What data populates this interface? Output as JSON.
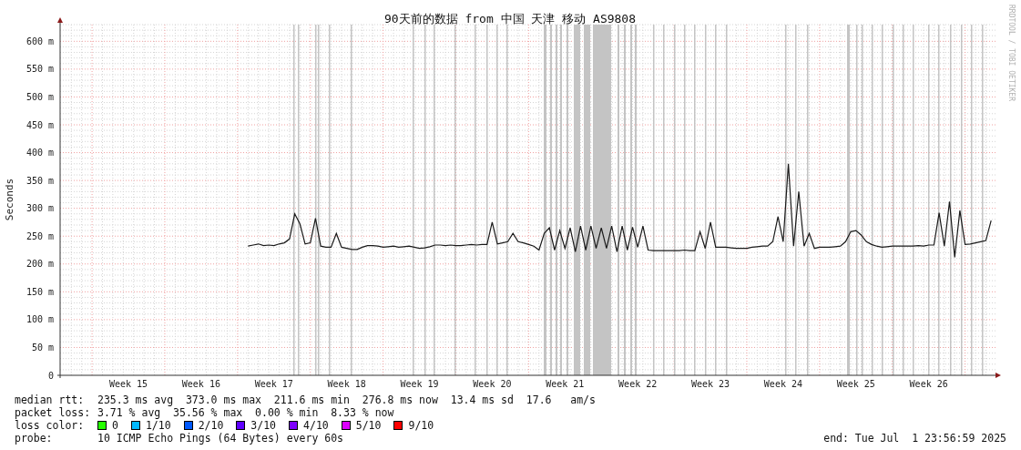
{
  "credit": "RRDTOOL / TOBI OETIKER",
  "chart_data": {
    "type": "line",
    "title": "90天前的数据 from 中国 天津 移动 AS9808",
    "ylabel": "Seconds",
    "grid": true,
    "ylim": [
      0,
      630
    ],
    "yticks": [
      {
        "value": 0,
        "label": "0"
      },
      {
        "value": 50,
        "label": "50 m"
      },
      {
        "value": 100,
        "label": "100 m"
      },
      {
        "value": 150,
        "label": "150 m"
      },
      {
        "value": 200,
        "label": "200 m"
      },
      {
        "value": 250,
        "label": "250 m"
      },
      {
        "value": 300,
        "label": "300 m"
      },
      {
        "value": 350,
        "label": "350 m"
      },
      {
        "value": 400,
        "label": "400 m"
      },
      {
        "value": 450,
        "label": "450 m"
      },
      {
        "value": 500,
        "label": "500 m"
      },
      {
        "value": 550,
        "label": "550 m"
      },
      {
        "value": 600,
        "label": "600 m"
      }
    ],
    "categories": [
      null,
      null,
      null,
      null,
      null,
      null,
      null,
      null,
      null,
      null,
      null,
      null,
      null,
      "Week 15",
      null,
      null,
      null,
      null,
      null,
      null,
      null,
      null,
      null,
      null,
      null,
      null,
      null,
      "Week 16",
      null,
      null,
      null,
      null,
      null,
      null,
      null,
      null,
      null,
      null,
      null,
      null,
      null,
      "Week 17",
      null,
      null,
      null,
      null,
      null,
      null,
      null,
      null,
      null,
      null,
      null,
      null,
      null,
      "Week 18",
      null,
      null,
      null,
      null,
      null,
      null,
      null,
      null,
      null,
      null,
      null,
      null,
      null,
      "Week 19",
      null,
      null,
      null,
      null,
      null,
      null,
      null,
      null,
      null,
      null,
      null,
      null,
      null,
      "Week 20",
      null,
      null,
      null,
      null,
      null,
      null,
      null,
      null,
      null,
      null,
      null,
      null,
      null,
      "Week 21",
      null,
      null,
      null,
      null,
      null,
      null,
      null,
      null,
      null,
      null,
      null,
      null,
      null,
      "Week 22",
      null,
      null,
      null,
      null,
      null,
      null,
      null,
      null,
      null,
      null,
      null,
      null,
      null,
      "Week 23",
      null,
      null,
      null,
      null,
      null,
      null,
      null,
      null,
      null,
      null,
      null,
      null,
      null,
      "Week 24",
      null,
      null,
      null,
      null,
      null,
      null,
      null,
      null,
      null,
      null,
      null,
      null,
      null,
      "Week 25",
      null,
      null,
      null,
      null,
      null,
      null,
      null,
      null,
      null,
      null,
      null,
      null,
      null,
      "Week 26",
      null,
      null,
      null,
      null,
      null,
      null,
      null,
      null,
      null,
      null,
      null,
      null
    ],
    "series": [
      {
        "color": "#1a1a1a",
        "values": [
          null,
          null,
          null,
          null,
          null,
          null,
          null,
          null,
          null,
          null,
          null,
          null,
          null,
          null,
          null,
          null,
          null,
          null,
          null,
          null,
          null,
          null,
          null,
          null,
          null,
          null,
          null,
          null,
          null,
          null,
          null,
          null,
          null,
          null,
          null,
          null,
          232,
          234,
          236,
          233,
          234,
          233,
          236,
          238,
          245,
          290,
          272,
          236,
          238,
          282,
          232,
          230,
          230,
          255,
          230,
          228,
          226,
          226,
          230,
          233,
          233,
          232,
          230,
          231,
          232,
          230,
          231,
          232,
          230,
          228,
          229,
          231,
          234,
          234,
          233,
          234,
          233,
          233,
          234,
          235,
          234,
          235,
          235,
          275,
          236,
          238,
          240,
          255,
          240,
          238,
          235,
          232,
          225,
          255,
          265,
          225,
          260,
          228,
          265,
          222,
          268,
          225,
          268,
          228,
          265,
          228,
          268,
          222,
          268,
          225,
          266,
          230,
          268,
          225,
          224,
          224,
          224,
          224,
          224,
          224,
          225,
          224,
          224,
          258,
          228,
          275,
          230,
          230,
          230,
          229,
          228,
          228,
          228,
          230,
          231,
          232,
          232,
          240,
          285,
          240,
          380,
          232,
          330,
          232,
          255,
          228,
          230,
          230,
          230,
          231,
          232,
          240,
          258,
          260,
          252,
          240,
          235,
          232,
          230,
          231,
          232,
          232,
          232,
          232,
          232,
          233,
          232,
          234,
          234,
          292,
          232,
          312,
          212,
          296,
          235,
          236,
          238,
          240,
          242,
          278
        ]
      }
    ]
  },
  "legend": {
    "stats": [
      {
        "label": "median rtt:",
        "text": "235.3 ms avg  373.0 ms max  211.6 ms min  276.8 ms now  13.4 ms sd  17.6   am/s"
      },
      {
        "label": "packet loss:",
        "text": "3.71 % avg  35.56 % max  0.00 % min  8.33 % now"
      }
    ],
    "loss_label": "loss color:",
    "loss_colors": [
      {
        "label": "0",
        "color": "#26ff00"
      },
      {
        "label": "1/10",
        "color": "#00b8ff"
      },
      {
        "label": "2/10",
        "color": "#0059ff"
      },
      {
        "label": "3/10",
        "color": "#5e00ff"
      },
      {
        "label": "4/10",
        "color": "#7e00ff"
      },
      {
        "label": "5/10",
        "color": "#dd00ff"
      },
      {
        "label": "9/10",
        "color": "#ff0000"
      }
    ],
    "probe_label": "probe:",
    "probe": "10 ICMP Echo Pings (64 Bytes) every 60s",
    "end": "end: Tue Jul  1 23:56:59 2025"
  }
}
